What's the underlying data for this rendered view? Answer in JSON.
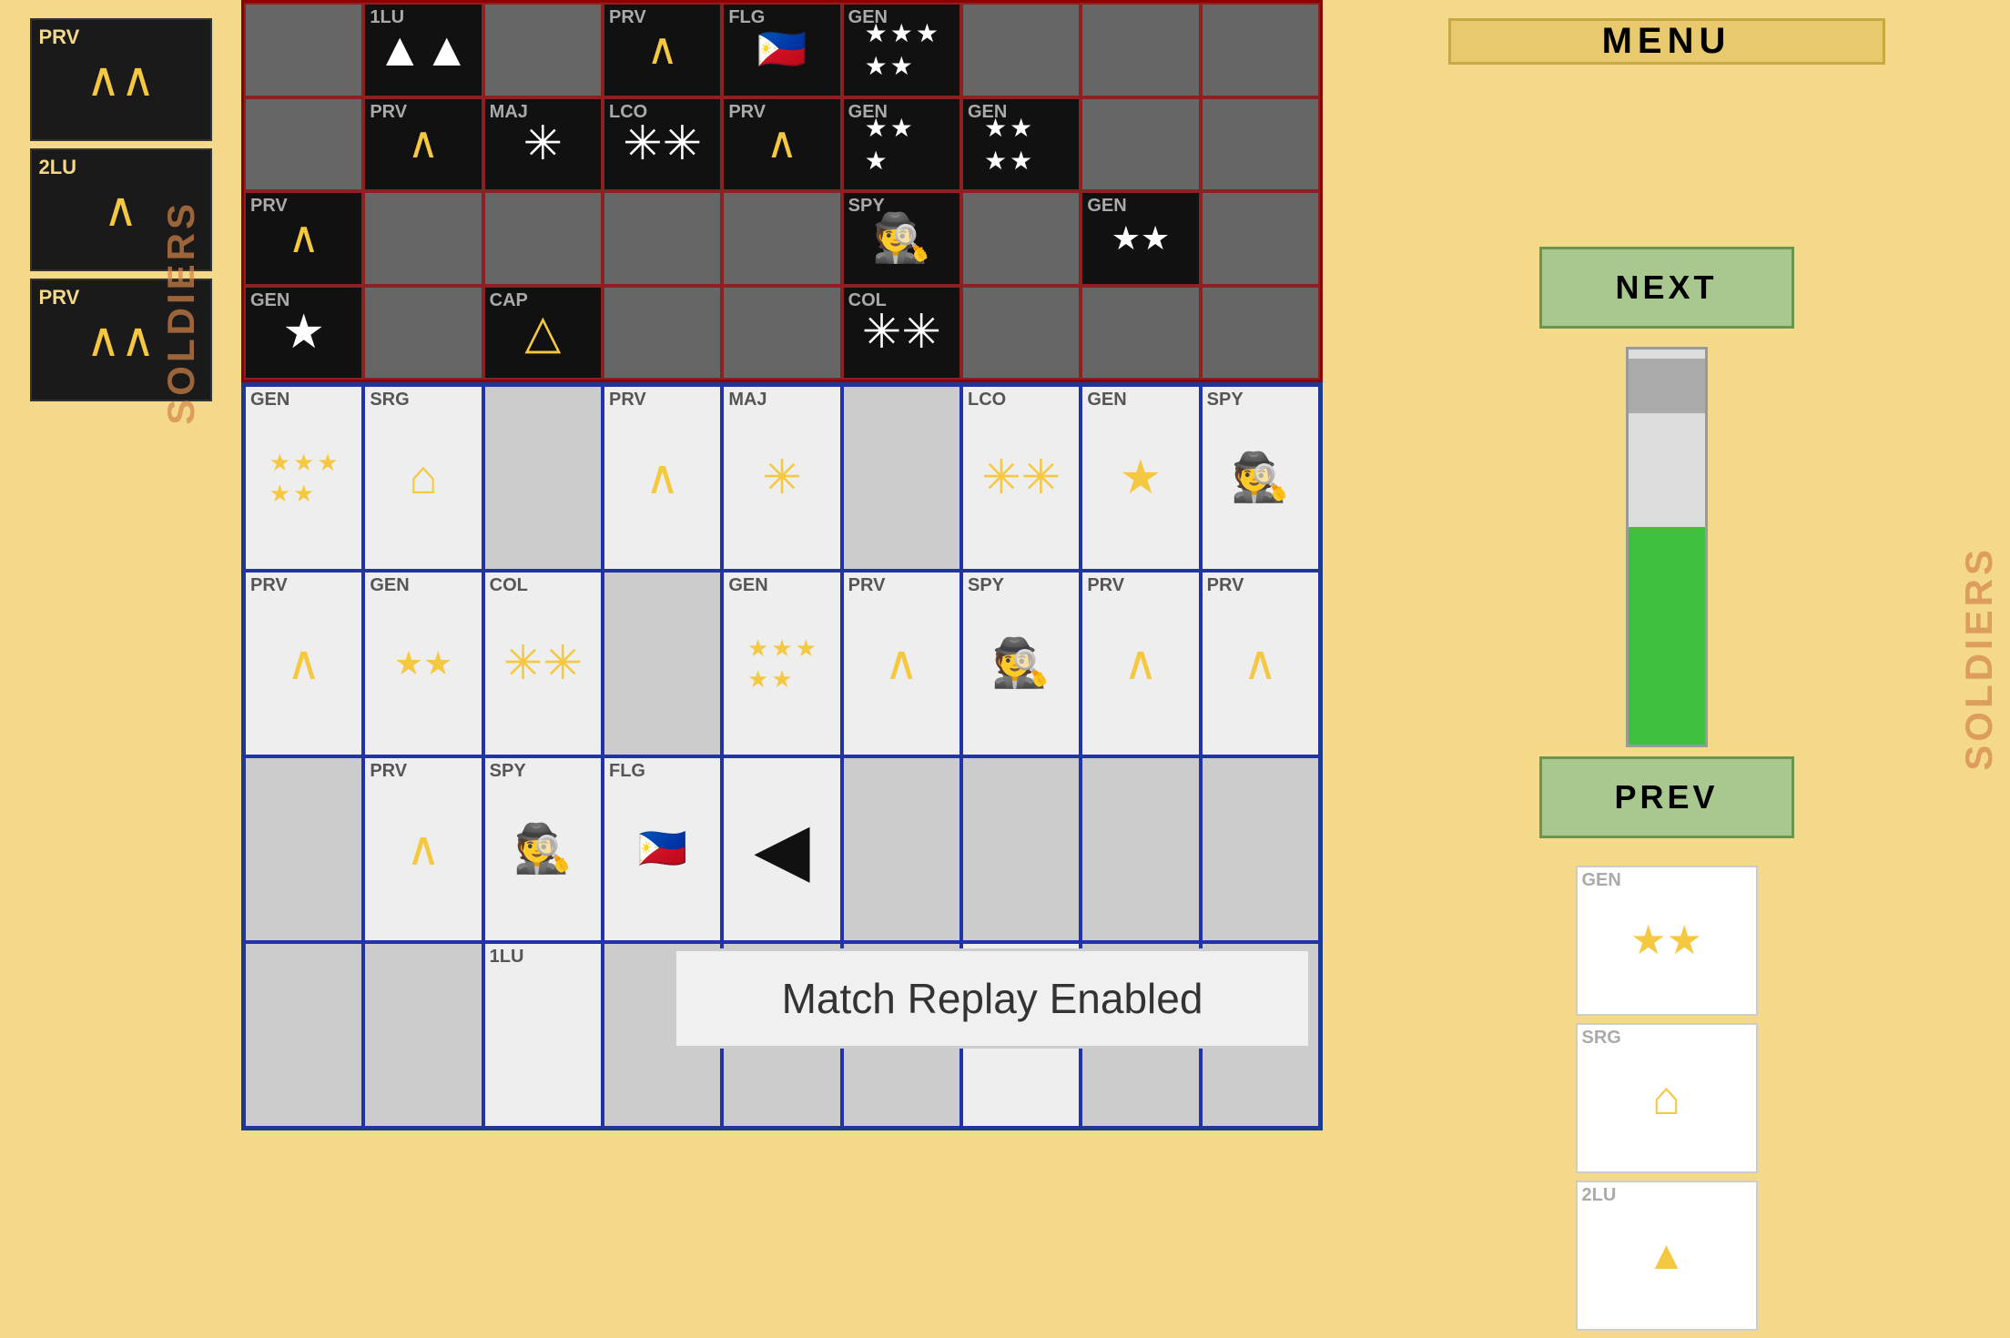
{
  "colors": {
    "background": "#f5d98b",
    "dark_board": "#666",
    "light_board": "#ccc",
    "dark_border": "#8b0000",
    "light_border": "#00008b",
    "menu_bg": "#e8c96e",
    "next_bg": "#a8c890",
    "progress_green": "#40c040",
    "progress_gray": "#aaa"
  },
  "left_sidebar": {
    "ranks": [
      {
        "label": "PRV",
        "symbol": "^^"
      },
      {
        "label": "2LU",
        "symbol": "^"
      },
      {
        "label": "PRV",
        "symbol": "^^"
      }
    ],
    "soldiers_label": "SOLDIERS"
  },
  "right_panel": {
    "menu_label": "MENU",
    "next_label": "NEXT",
    "prev_label": "PREV",
    "progress_pct": 55,
    "soldiers_label": "SOLDIERS",
    "rank_cards": [
      {
        "label": "GEN",
        "symbol": "★★"
      },
      {
        "label": "SRG",
        "symbol": "⌂"
      },
      {
        "label": "2LU",
        "symbol": "▲"
      }
    ]
  },
  "notification": {
    "text": "Match Replay Enabled"
  },
  "board": {
    "top_rows": 4,
    "top_cols": 9,
    "bottom_rows": 4,
    "bottom_cols": 9
  }
}
